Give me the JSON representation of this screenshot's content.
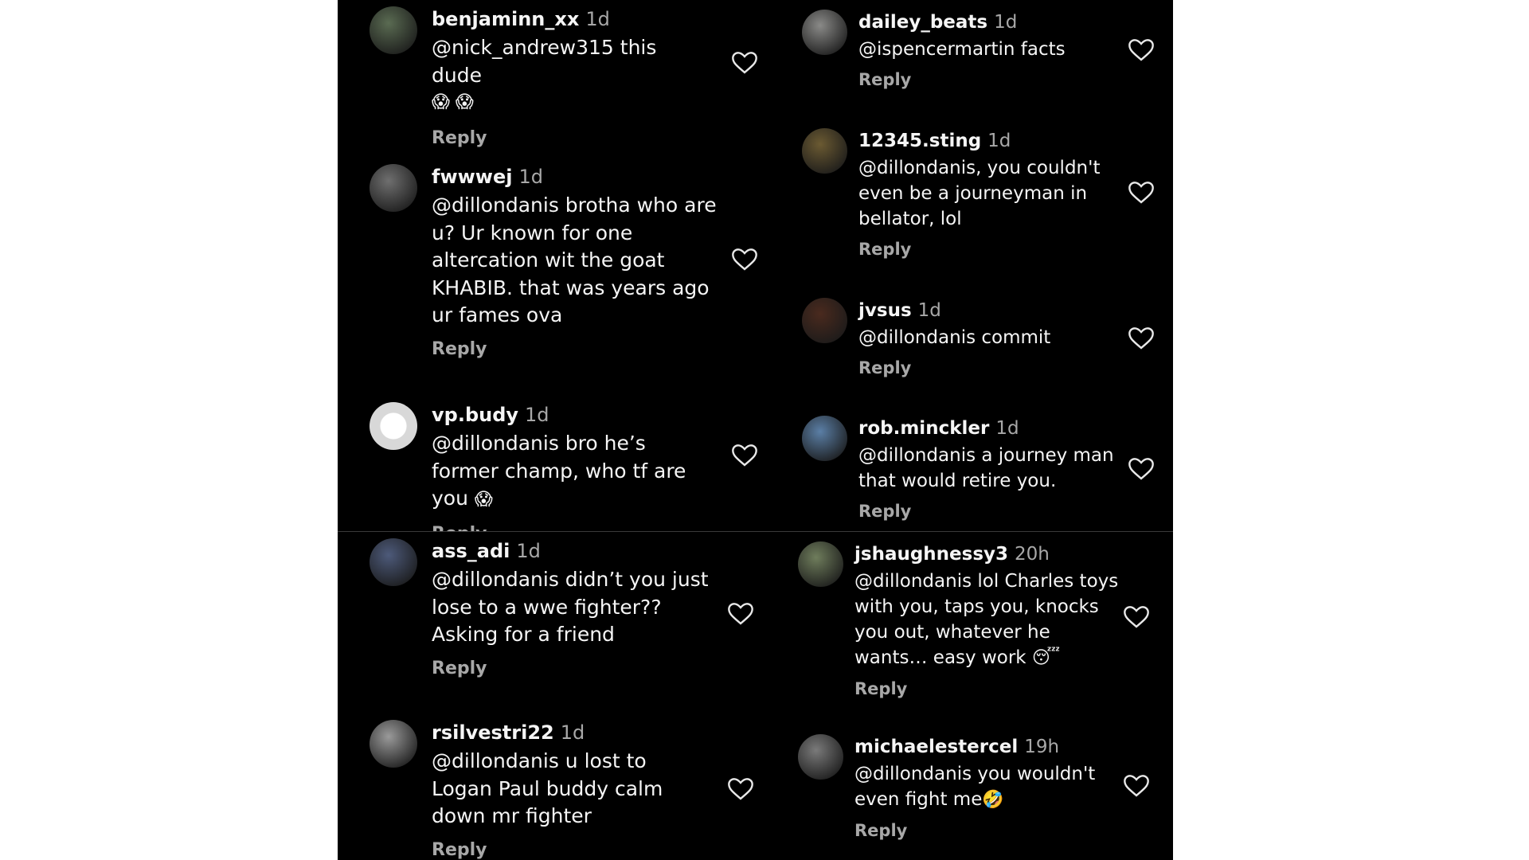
{
  "panels": [
    {
      "comments": [
        {
          "user": "benjaminn_xx",
          "time": "1d",
          "text": "@nick_andrew315 this dude",
          "emoji": "😱 😱",
          "reply": "Reply",
          "avatar_color": "#5a6b52"
        },
        {
          "user": "fwwwej",
          "time": "1d",
          "text": "@dillondanis brotha who are u? Ur known for one altercation wit the goat KHABIB. that was years ago ur fames ova",
          "reply": "Reply",
          "avatar_color": "#6f6f6f"
        },
        {
          "user": "vp.budy",
          "time": "1d",
          "text": "@dillondanis bro he’s former champ, who tf are you",
          "emoji": "😱",
          "reply": "Reply",
          "avatar_color": "#e6e6e6"
        }
      ]
    },
    {
      "comments": [
        {
          "user": "dailey_beats",
          "time": "1d",
          "text": "@ispencermartin facts",
          "reply": "Reply",
          "avatar_color": "#8a8a88"
        },
        {
          "user": "12345.sting",
          "time": "1d",
          "text": "@dillondanis, you couldn't even be a journeyman in bellator, lol",
          "reply": "Reply",
          "avatar_color": "#6b5a32"
        },
        {
          "user": "jvsus",
          "time": "1d",
          "text": "@dillondanis commit",
          "reply": "Reply",
          "avatar_color": "#4a2a1e"
        },
        {
          "user": "rob.minckler",
          "time": "1d",
          "text": "@dillondanis a journey man that would retire you.",
          "reply": "Reply",
          "avatar_color": "#5b7fa6"
        }
      ]
    },
    {
      "comments": [
        {
          "user": "ass_adi",
          "time": "1d",
          "text": "@dillondanis didn’t you just lose to a wwe fighter?? Asking for a friend",
          "reply": "Reply",
          "avatar_color": "#4d5a7a"
        },
        {
          "user": "rsilvestri22",
          "time": "1d",
          "text": "@dillondanis u lost to Logan Paul buddy calm down mr fighter",
          "reply": "Reply",
          "avatar_color": "#9a9a9a"
        }
      ]
    },
    {
      "comments": [
        {
          "user": "jshaughnessy3",
          "time": "20h",
          "text": "@dillondanis lol Charles toys with you, taps you, knocks you out, whatever he wants… easy work",
          "emoji": "😴",
          "reply": "Reply",
          "avatar_color": "#6f7d5c"
        },
        {
          "user": "michaelestercel",
          "time": "19h",
          "text": "@dillondanis you wouldn't even fight me",
          "emoji": "🤣",
          "reply": "Reply",
          "avatar_color": "#7a7a7a"
        }
      ]
    }
  ]
}
